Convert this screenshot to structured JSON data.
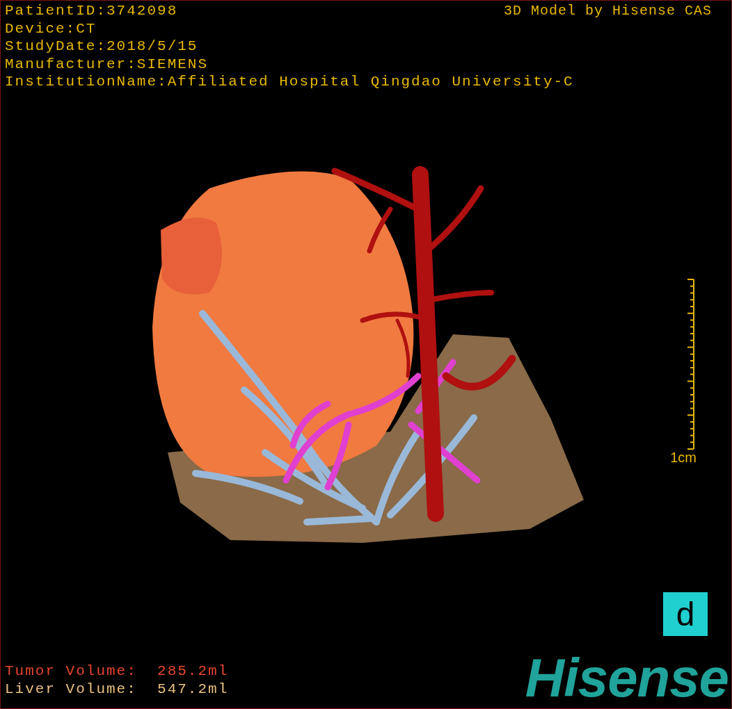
{
  "info_lines": [
    "PatientID:3742098",
    "Device:CT",
    "StudyDate:2018/5/15",
    "Manufacturer:SIEMENS",
    "InstitutionName:Affiliated Hospital Qingdao University-C"
  ],
  "title": "3D Model by Hisense CAS",
  "scale_bar": {
    "label": "1cm"
  },
  "panel_label": "d",
  "volumes": [
    {
      "text": "Tumor Volume:  285.2ml",
      "color": "#e8452f"
    },
    {
      "text": "Liver Volume:  547.2ml",
      "color": "#e8c080"
    }
  ],
  "logo": "Hisense"
}
